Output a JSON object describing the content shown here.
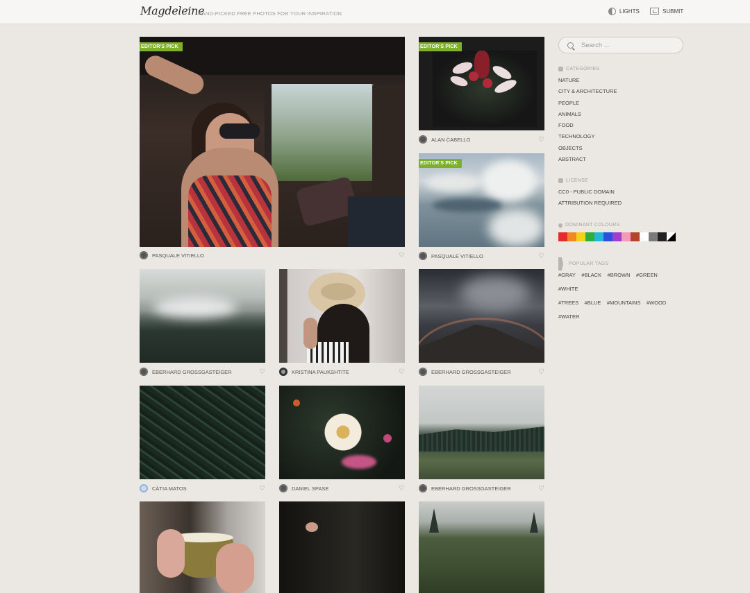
{
  "header": {
    "logo": "Magdeleine",
    "tagline": "HAND-PICKED FREE PHOTOS FOR YOUR INSPIRATION",
    "lights_label": "LIGHTS",
    "submit_label": "SUBMIT"
  },
  "search": {
    "placeholder": "Search ..."
  },
  "badge_label": "EDITOR'S PICK",
  "photos": [
    {
      "author": "PASQUALE VITIELLO",
      "editors_pick": true
    },
    {
      "author": "ALAN CABELLO",
      "editors_pick": true
    },
    {
      "author": "PASQUALE VITIELLO",
      "editors_pick": true
    },
    {
      "author": "EBERHARD GROSSGASTEIGER",
      "editors_pick": false
    },
    {
      "author": "KRISTINA PAUKSHTITE",
      "editors_pick": false
    },
    {
      "author": "EBERHARD GROSSGASTEIGER",
      "editors_pick": false
    },
    {
      "author": "CÁTIA MATOS",
      "editors_pick": false
    },
    {
      "author": "DANIEL SPASE",
      "editors_pick": false
    },
    {
      "author": "EBERHARD GROSSGASTEIGER",
      "editors_pick": false
    }
  ],
  "sidebar": {
    "categories_title": "CATEGORIES",
    "categories": [
      "NATURE",
      "CITY & ARCHITECTURE",
      "PEOPLE",
      "ANIMALS",
      "FOOD",
      "TECHNOLOGY",
      "OBJECTS",
      "ABSTRACT"
    ],
    "license_title": "LICENSE",
    "licenses": [
      "CC0 - PUBLIC DOMAIN",
      "ATTRIBUTION REQUIRED"
    ],
    "colours_title": "DOMINANT COLOURS",
    "colours": [
      "#e52b2b",
      "#f08a1f",
      "#f2d31b",
      "#2fae3c",
      "#25b7d8",
      "#2d4fe0",
      "#a03ccf",
      "#f29ab6",
      "#b5432c",
      "#ffffff",
      "#7a7a7a",
      "#222222",
      "#000000"
    ],
    "tags_title": "POPULAR TAGS",
    "tags": [
      "#GRAY",
      "#BLACK",
      "#BROWN",
      "#GREEN",
      "#WHITE",
      "#TREES",
      "#BLUE",
      "#MOUNTAINS",
      "#WOOD",
      "#WATER"
    ]
  }
}
